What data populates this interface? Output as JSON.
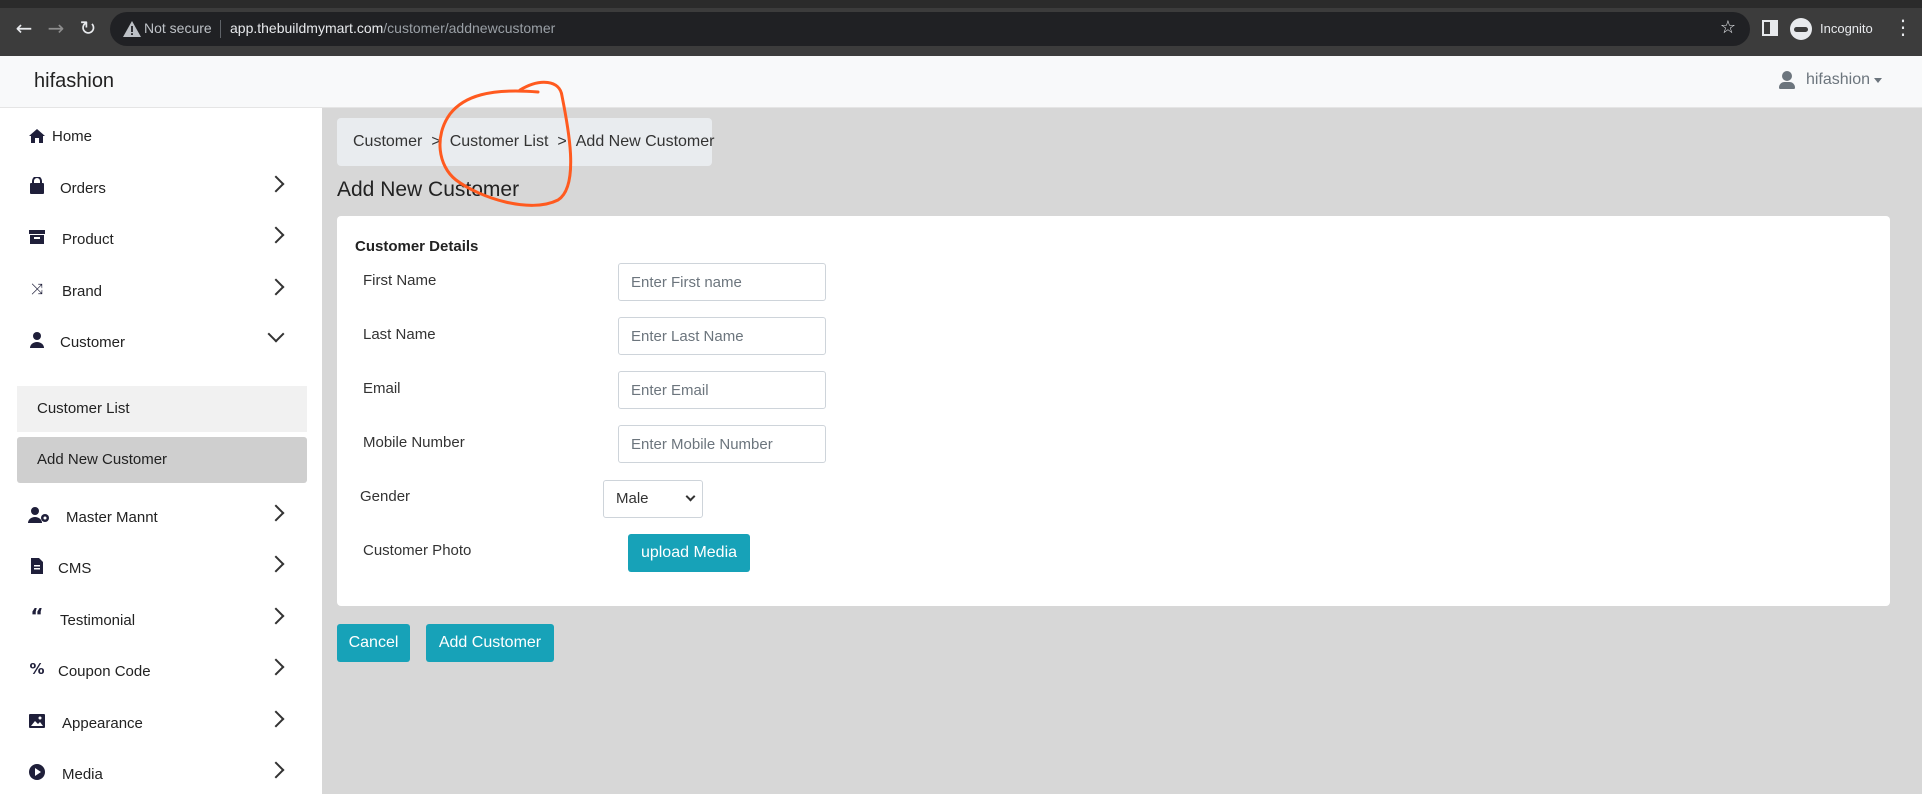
{
  "browser": {
    "not_secure": "Not secure",
    "url_host": "app.thebuildmymart.com",
    "url_path": "/customer/addnewcustomer",
    "profile_label": "Incognito",
    "icons": [
      "back-arrow-icon",
      "forward-arrow-icon",
      "reload-icon",
      "warning-icon",
      "star-icon",
      "side-panel-icon",
      "incognito-icon",
      "kebab-menu-icon"
    ]
  },
  "header": {
    "brand": "hifashion",
    "user": "hifashion"
  },
  "sidebar": {
    "items": [
      {
        "label": "Home",
        "icon": "home-icon"
      },
      {
        "label": "Orders",
        "icon": "shopping-bag-icon"
      },
      {
        "label": "Product",
        "icon": "archive-box-icon"
      },
      {
        "label": "Brand",
        "icon": "shuffle-icon"
      },
      {
        "label": "Customer",
        "icon": "user-icon"
      },
      {
        "label": "Master Mannt",
        "icon": "user-gear-icon"
      },
      {
        "label": "CMS",
        "icon": "document-icon"
      },
      {
        "label": "Testimonial",
        "icon": "quote-icon"
      },
      {
        "label": "Coupon Code",
        "icon": "percent-icon"
      },
      {
        "label": "Appearance",
        "icon": "image-icon"
      },
      {
        "label": "Media",
        "icon": "play-circle-icon"
      }
    ],
    "sub_items": [
      "Customer List",
      "Add New Customer"
    ]
  },
  "breadcrumb": {
    "items": [
      "Customer",
      "Customer List",
      "Add New Customer"
    ],
    "separator": ">"
  },
  "page_title": "Add New Customer",
  "form": {
    "section_title": "Customer Details",
    "first_name_label": "First Name",
    "first_name_placeholder": "Enter First name",
    "last_name_label": "Last Name",
    "last_name_placeholder": "Enter Last Name",
    "email_label": "Email",
    "email_placeholder": "Enter Email",
    "mobile_label": "Mobile Number",
    "mobile_placeholder": "Enter Mobile Number",
    "gender_label": "Gender",
    "gender_value": "Male",
    "photo_label": "Customer Photo",
    "upload_label": "upload Media"
  },
  "actions": {
    "cancel": "Cancel",
    "add": "Add Customer"
  },
  "colors": {
    "accent": "#17a2b8",
    "annotation": "#ff5a1f"
  }
}
